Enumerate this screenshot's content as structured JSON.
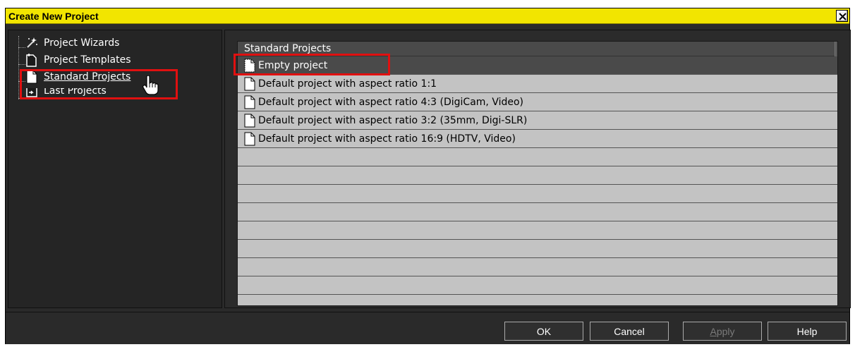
{
  "window": {
    "title": "Create New Project",
    "close_icon": "close-icon"
  },
  "tree": {
    "items": [
      {
        "label": "Project Wizards",
        "icon": "wand-icon"
      },
      {
        "label": "Project Templates",
        "icon": "template-icon"
      },
      {
        "label": "Standard Projects",
        "icon": "document-icon",
        "selected": true
      },
      {
        "label": "Last Projects",
        "icon": "recent-icon"
      }
    ]
  },
  "list": {
    "header": "Standard Projects",
    "items": [
      {
        "label": "Empty project",
        "selected": true
      },
      {
        "label": "Default project with aspect ratio 1:1"
      },
      {
        "label": "Default project with aspect ratio 4:3 (DigiCam, Video)"
      },
      {
        "label": "Default project with aspect ratio 3:2 (35mm, Digi-SLR)"
      },
      {
        "label": "Default project with aspect ratio 16:9 (HDTV, Video)"
      }
    ]
  },
  "buttons": {
    "ok": "OK",
    "cancel": "Cancel",
    "apply_first": "A",
    "apply_rest": "pply",
    "help": "Help"
  },
  "colors": {
    "title_bar": "#f2e500",
    "highlight": "#e01010",
    "list_bg": "#c3c3c3",
    "selected_row": "#4a4a4a"
  }
}
